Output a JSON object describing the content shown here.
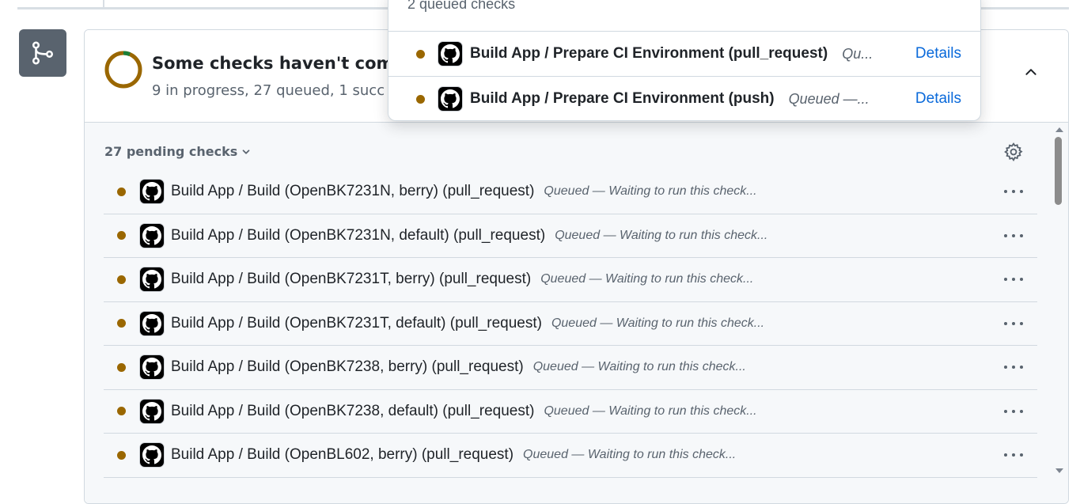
{
  "merge_box": {
    "status_title": "Some checks haven't compl",
    "status_summary": "9 in progress, 27 queued, 1 succ",
    "pending_toggle_label": "27 pending checks"
  },
  "checks": [
    {
      "name": "Build App / Build (OpenBK7231N, berry) (pull_request)",
      "status": "Queued — Waiting to run this check..."
    },
    {
      "name": "Build App / Build (OpenBK7231N, default) (pull_request)",
      "status": "Queued — Waiting to run this check..."
    },
    {
      "name": "Build App / Build (OpenBK7231T, berry) (pull_request)",
      "status": "Queued — Waiting to run this check..."
    },
    {
      "name": "Build App / Build (OpenBK7231T, default) (pull_request)",
      "status": "Queued — Waiting to run this check..."
    },
    {
      "name": "Build App / Build (OpenBK7238, berry) (pull_request)",
      "status": "Queued — Waiting to run this check..."
    },
    {
      "name": "Build App / Build (OpenBK7238, default) (pull_request)",
      "status": "Queued — Waiting to run this check..."
    },
    {
      "name": "Build App / Build (OpenBL602, berry) (pull_request)",
      "status": "Queued — Waiting to run this check..."
    }
  ],
  "popover": {
    "header": "2 queued checks",
    "rows": [
      {
        "name": "Build App / Prepare CI Environment (pull_request)",
        "status": "Qu...",
        "details_label": "Details"
      },
      {
        "name": "Build App / Prepare CI Environment (push)",
        "status": "Queued —...",
        "details_label": "Details"
      }
    ]
  },
  "colors": {
    "queued_dot": "#9a6700",
    "link": "#0969da",
    "badge_bg": "#59636e",
    "ring_pending": "#9a6700",
    "ring_success": "#1a7f37"
  },
  "icons": {
    "branch": "git-merge-icon",
    "collapse": "chevron-up-icon",
    "settings": "gear-icon",
    "row_menu": "kebab-horizontal-icon",
    "toggle": "chevron-down-icon",
    "app": "github-logo-icon"
  }
}
